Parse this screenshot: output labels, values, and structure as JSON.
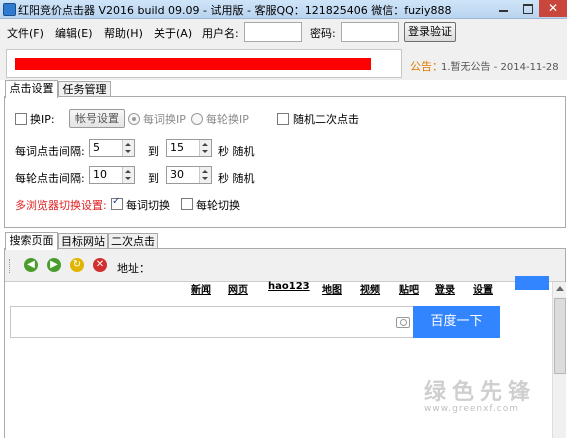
{
  "window": {
    "title": "红阳竞价点击器 V2016 build 09.09 - 试用版 - 客服QQ：121825406 微信：fuziy888",
    "close_glyph": "✕"
  },
  "menu": {
    "items": [
      "文件(F)",
      "编辑(E)",
      "帮助(H)",
      "关于(A)"
    ],
    "username_label": "用户名:",
    "username_value": "",
    "password_label": "密码:",
    "password_value": "",
    "login_button": "登录验证"
  },
  "notice": {
    "label": "公告：",
    "text": "1.暂无公告 - 2014-11-28",
    "marquee_color": "#ff0000"
  },
  "top_tabs": [
    "点击设置",
    "任务管理"
  ],
  "settings": {
    "change_ip": {
      "label": "换IP:",
      "checked": false
    },
    "account_button": "帐号设置",
    "radio_per_word": {
      "label": "每词换IP",
      "selected": true
    },
    "radio_per_round": {
      "label": "每轮换IP",
      "selected": false
    },
    "random_second_click": {
      "label": "随机二次点击",
      "checked": false
    },
    "word_interval": {
      "label": "每词点击间隔:",
      "from": "5",
      "to_label": "到",
      "to": "15",
      "unit": "秒 随机"
    },
    "round_interval": {
      "label": "每轮点击间隔:",
      "from": "10",
      "to_label": "到",
      "to": "30",
      "unit": "秒 随机"
    },
    "multi_browser": {
      "label": "多浏览器切换设置:",
      "per_word": {
        "label": "每词切换",
        "checked": true
      },
      "per_round": {
        "label": "每轮切换",
        "checked": false
      }
    }
  },
  "bottom_tabs": [
    "搜索页面",
    "目标网站",
    "二次点击"
  ],
  "browser": {
    "address_label": "地址：",
    "icons": [
      "back-icon",
      "forward-icon",
      "refresh-icon",
      "stop-icon"
    ],
    "baidu_nav": [
      "新闻",
      "网页",
      "hao123",
      "地图",
      "视频",
      "贴吧",
      "登录",
      "设置"
    ],
    "search_button": "百度一下"
  },
  "watermark": {
    "line1": "绿色先锋",
    "line2": "www.greenxf.com"
  }
}
